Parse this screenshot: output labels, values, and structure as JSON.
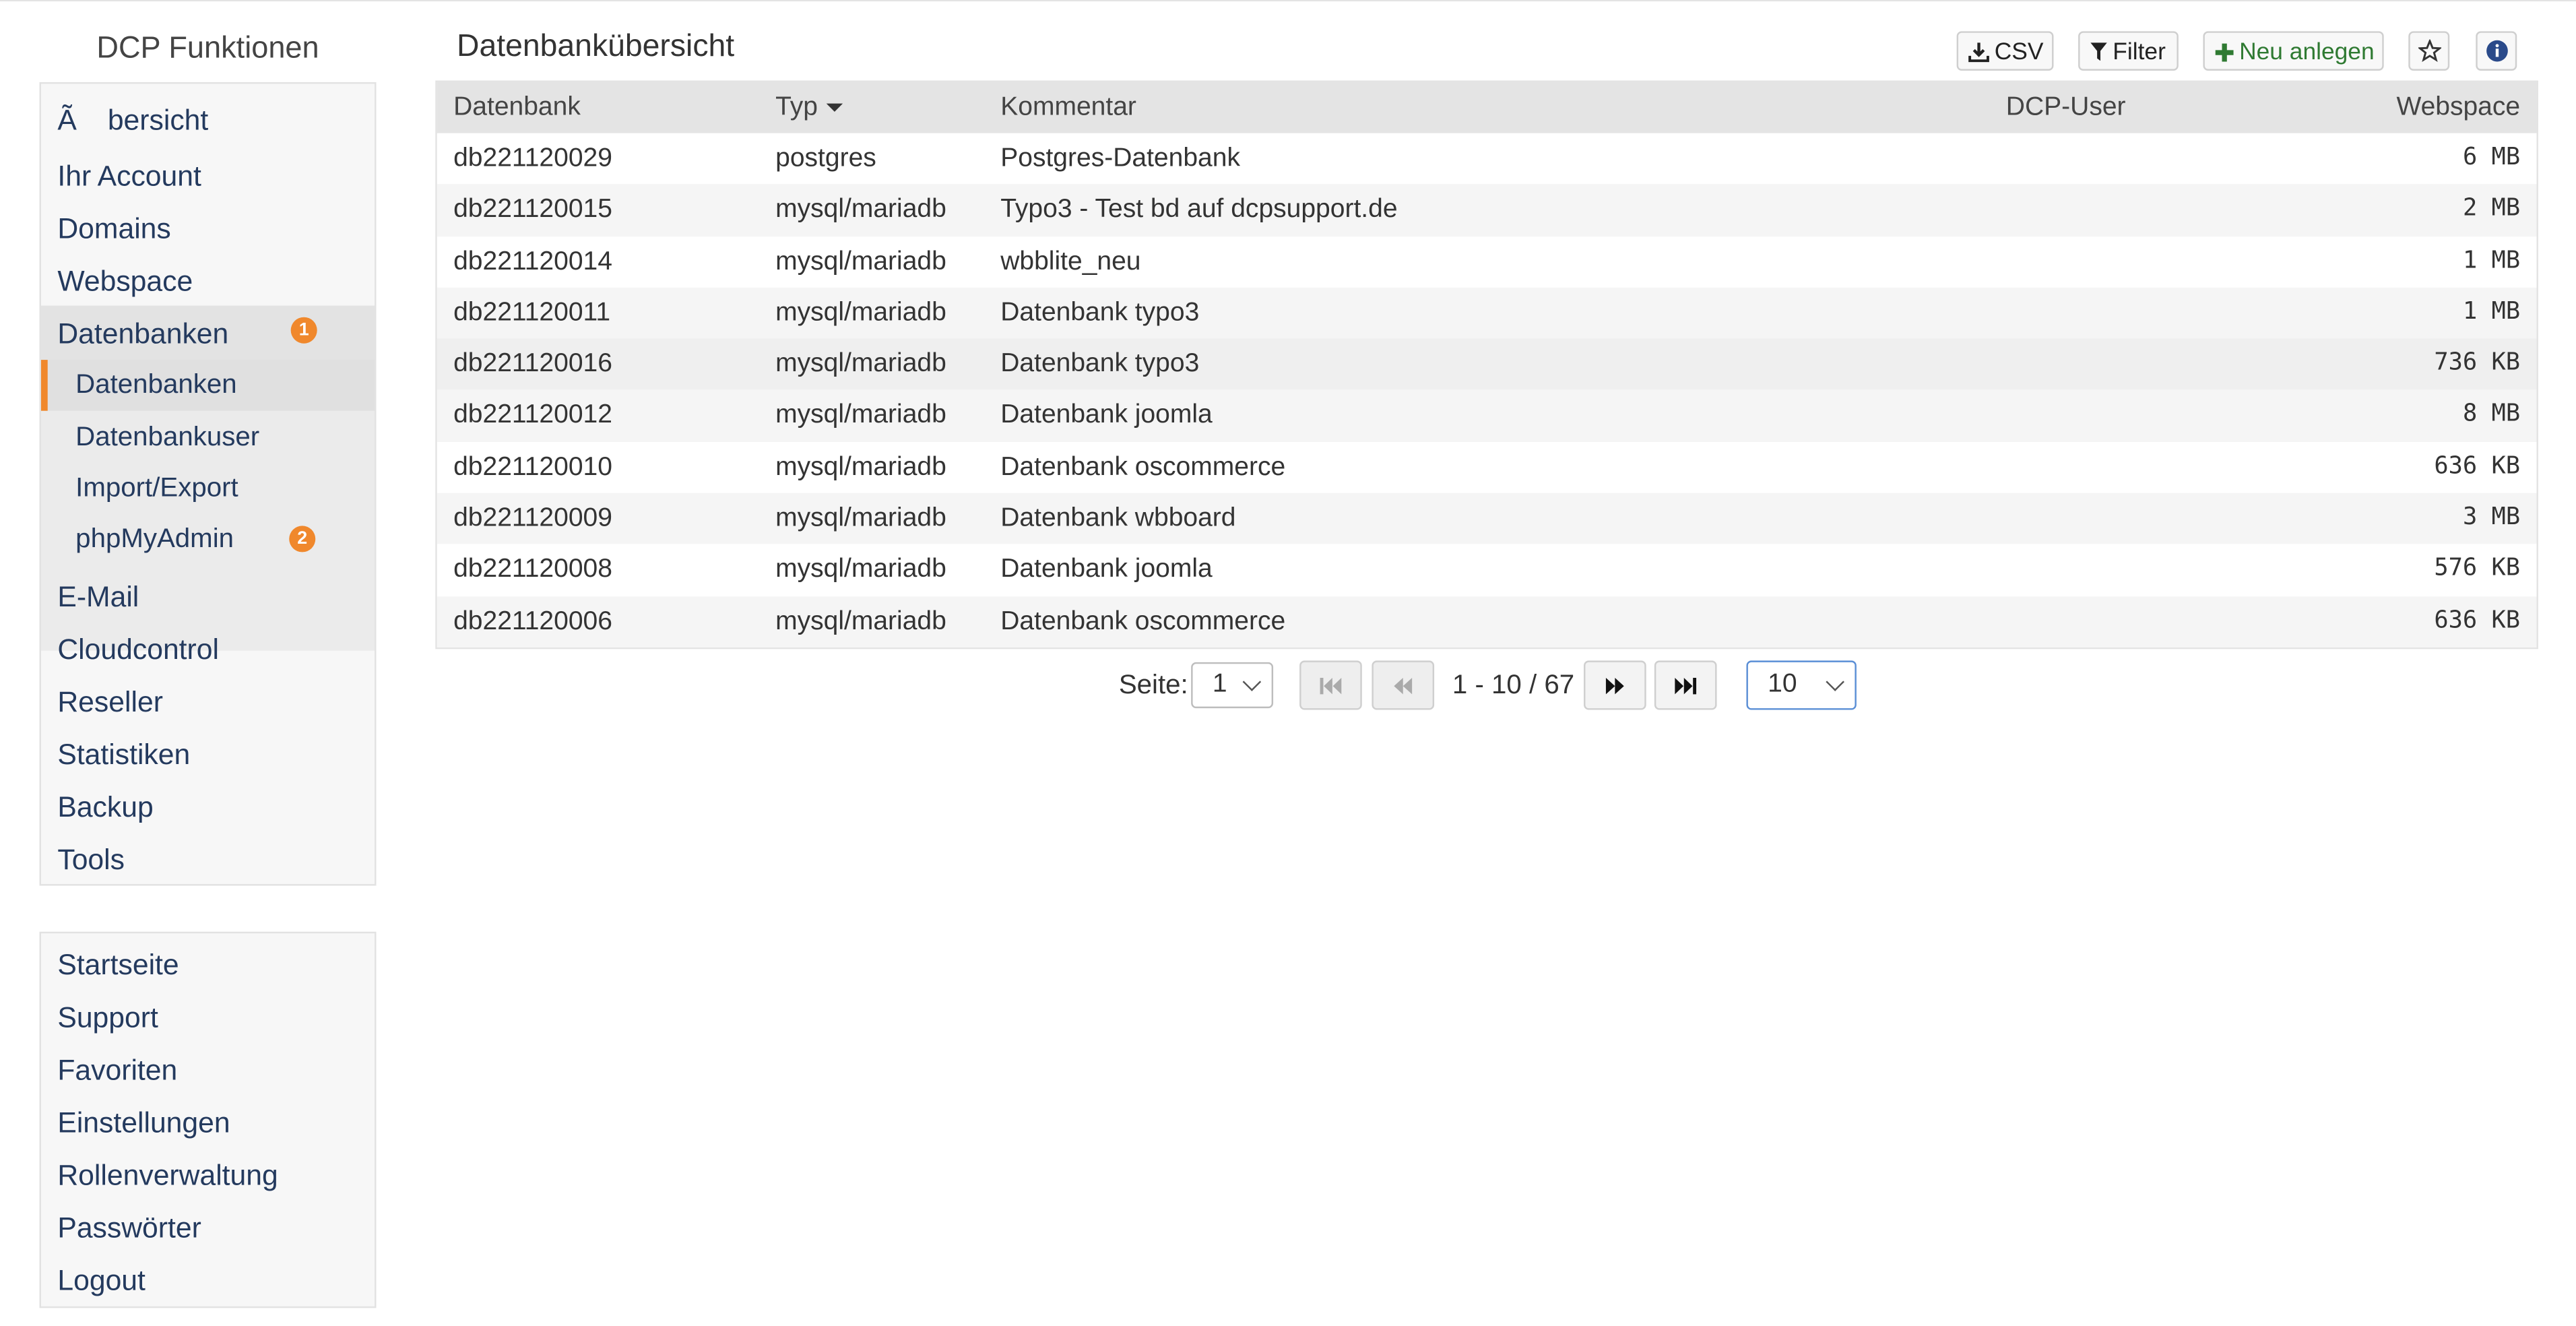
{
  "sidebar": {
    "title": "DCP Funktionen",
    "items": [
      "Ã bersicht",
      "Ihr Account",
      "Domains",
      "Webspace",
      "Datenbanken"
    ],
    "datenbanken_badge": "1",
    "sub_items": [
      "Datenbanken",
      "Datenbankuser",
      "Import/Export",
      "phpMyAdmin"
    ],
    "phpmyadmin_badge": "2",
    "items_after": [
      "E-Mail",
      "Cloudcontrol",
      "Reseller",
      "Statistiken",
      "Backup",
      "Tools"
    ],
    "bottom_items": [
      "Startseite",
      "Support",
      "Favoriten",
      "Einstellungen",
      "Rollenverwaltung",
      "Passwörter",
      "Logout"
    ]
  },
  "header": {
    "title": "Datenbankübersicht",
    "csv_label": "CSV",
    "filter_label": "Filter",
    "new_label": "Neu anlegen"
  },
  "table": {
    "columns": [
      "Datenbank",
      "Typ",
      "Kommentar",
      "DCP-User",
      "Webspace"
    ],
    "rows": [
      {
        "db": "db221120029",
        "typ": "postgres",
        "kommentar": "Postgres-Datenbank",
        "user": "",
        "webspace": "6 MB"
      },
      {
        "db": "db221120015",
        "typ": "mysql/mariadb",
        "kommentar": "Typo3 - Test bd auf dcpsupport.de",
        "user": "",
        "webspace": "2 MB"
      },
      {
        "db": "db221120014",
        "typ": "mysql/mariadb",
        "kommentar": "wbblite_neu",
        "user": "",
        "webspace": "1 MB"
      },
      {
        "db": "db221120011",
        "typ": "mysql/mariadb",
        "kommentar": "Datenbank typo3",
        "user": "",
        "webspace": "1 MB"
      },
      {
        "db": "db221120016",
        "typ": "mysql/mariadb",
        "kommentar": "Datenbank typo3",
        "user": "",
        "webspace": "736 KB"
      },
      {
        "db": "db221120012",
        "typ": "mysql/mariadb",
        "kommentar": "Datenbank joomla",
        "user": "",
        "webspace": "8 MB"
      },
      {
        "db": "db221120010",
        "typ": "mysql/mariadb",
        "kommentar": "Datenbank oscommerce",
        "user": "",
        "webspace": "636 KB"
      },
      {
        "db": "db221120009",
        "typ": "mysql/mariadb",
        "kommentar": "Datenbank wbboard",
        "user": "",
        "webspace": "3 MB"
      },
      {
        "db": "db221120008",
        "typ": "mysql/mariadb",
        "kommentar": "Datenbank joomla",
        "user": "",
        "webspace": "576 KB"
      },
      {
        "db": "db221120006",
        "typ": "mysql/mariadb",
        "kommentar": "Datenbank oscommerce",
        "user": "",
        "webspace": "636 KB"
      }
    ]
  },
  "pagination": {
    "label": "Seite:",
    "page": "1",
    "range": "1 - 10 / 67",
    "per_page": "10"
  },
  "colors": {
    "accent_orange": "#f0882c",
    "nav_text": "#243a5e",
    "new_button_green": "#2f7a32"
  }
}
